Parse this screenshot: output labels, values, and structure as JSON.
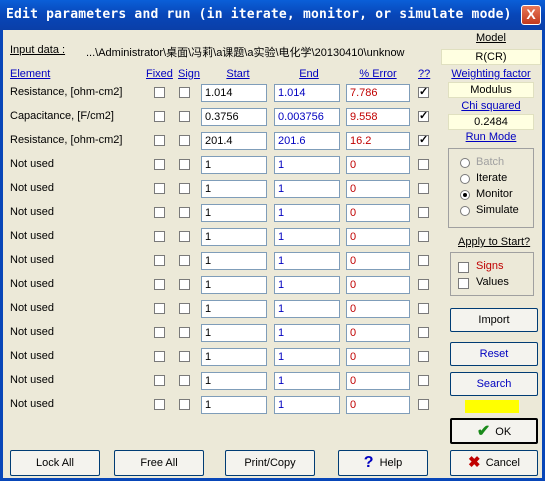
{
  "window": {
    "title": "Edit parameters and run (in iterate, monitor, or simulate mode)",
    "close_glyph": "X"
  },
  "input_data": {
    "label": "Input data :",
    "value": "...\\Administrator\\桌面\\冯莉\\a课题\\a实验\\电化学\\20130410\\unknow"
  },
  "headers": {
    "element": "Element",
    "fixed": "Fixed",
    "sign": "Sign",
    "start": "Start",
    "end": "End",
    "error": "% Error",
    "qq": "??"
  },
  "rows": [
    {
      "label": "Resistance,     [ohm-cm2]",
      "fixed": false,
      "sign": false,
      "start": "1.014",
      "end": "1.014",
      "error": "7.786",
      "qq": true
    },
    {
      "label": "Capacitance,     [F/cm2]",
      "fixed": false,
      "sign": false,
      "start": "0.3756",
      "end": "0.003756",
      "error": "9.558",
      "qq": true
    },
    {
      "label": "Resistance,     [ohm-cm2]",
      "fixed": false,
      "sign": false,
      "start": "201.4",
      "end": "201.6",
      "error": "16.2",
      "qq": true
    },
    {
      "label": "Not used",
      "fixed": false,
      "sign": false,
      "start": "1",
      "end": "1",
      "error": "0",
      "qq": false
    },
    {
      "label": "Not used",
      "fixed": false,
      "sign": false,
      "start": "1",
      "end": "1",
      "error": "0",
      "qq": false
    },
    {
      "label": "Not used",
      "fixed": false,
      "sign": false,
      "start": "1",
      "end": "1",
      "error": "0",
      "qq": false
    },
    {
      "label": "Not used",
      "fixed": false,
      "sign": false,
      "start": "1",
      "end": "1",
      "error": "0",
      "qq": false
    },
    {
      "label": "Not used",
      "fixed": false,
      "sign": false,
      "start": "1",
      "end": "1",
      "error": "0",
      "qq": false
    },
    {
      "label": "Not used",
      "fixed": false,
      "sign": false,
      "start": "1",
      "end": "1",
      "error": "0",
      "qq": false
    },
    {
      "label": "Not used",
      "fixed": false,
      "sign": false,
      "start": "1",
      "end": "1",
      "error": "0",
      "qq": false
    },
    {
      "label": "Not used",
      "fixed": false,
      "sign": false,
      "start": "1",
      "end": "1",
      "error": "0",
      "qq": false
    },
    {
      "label": "Not used",
      "fixed": false,
      "sign": false,
      "start": "1",
      "end": "1",
      "error": "0",
      "qq": false
    },
    {
      "label": "Not used",
      "fixed": false,
      "sign": false,
      "start": "1",
      "end": "1",
      "error": "0",
      "qq": false
    },
    {
      "label": "Not used",
      "fixed": false,
      "sign": false,
      "start": "1",
      "end": "1",
      "error": "0",
      "qq": false
    }
  ],
  "right_panel": {
    "model_label": "Model",
    "model_value": "R(CR)",
    "weighting_label": "Weighting factor",
    "weighting_value": "Modulus",
    "chi_label": "Chi squared",
    "chi_value": "0.2484",
    "run_mode_label": "Run Mode",
    "run_modes": [
      {
        "label": "Batch",
        "selected": false,
        "disabled": true
      },
      {
        "label": "Iterate",
        "selected": false,
        "disabled": false
      },
      {
        "label": "Monitor",
        "selected": true,
        "disabled": false
      },
      {
        "label": "Simulate",
        "selected": false,
        "disabled": false
      }
    ],
    "apply_label": "Apply to Start?",
    "apply_signs": "Signs",
    "apply_values": "Values",
    "import": "Import",
    "reset": "Reset",
    "search": "Search",
    "status_color": "#ffff00",
    "ok": "OK",
    "ok_icon": "checkmark-icon",
    "cancel": "Cancel",
    "cancel_icon": "x-icon"
  },
  "bottom_buttons": {
    "lock_all": "Lock All",
    "free_all": "Free All",
    "print_copy": "Print/Copy",
    "help": "Help",
    "help_icon": "question-icon"
  },
  "colors": {
    "title_bar": "#0846b8",
    "dialog_bg": "#ece9d8",
    "link_blue": "#0000c0",
    "error_red": "#c00000"
  }
}
